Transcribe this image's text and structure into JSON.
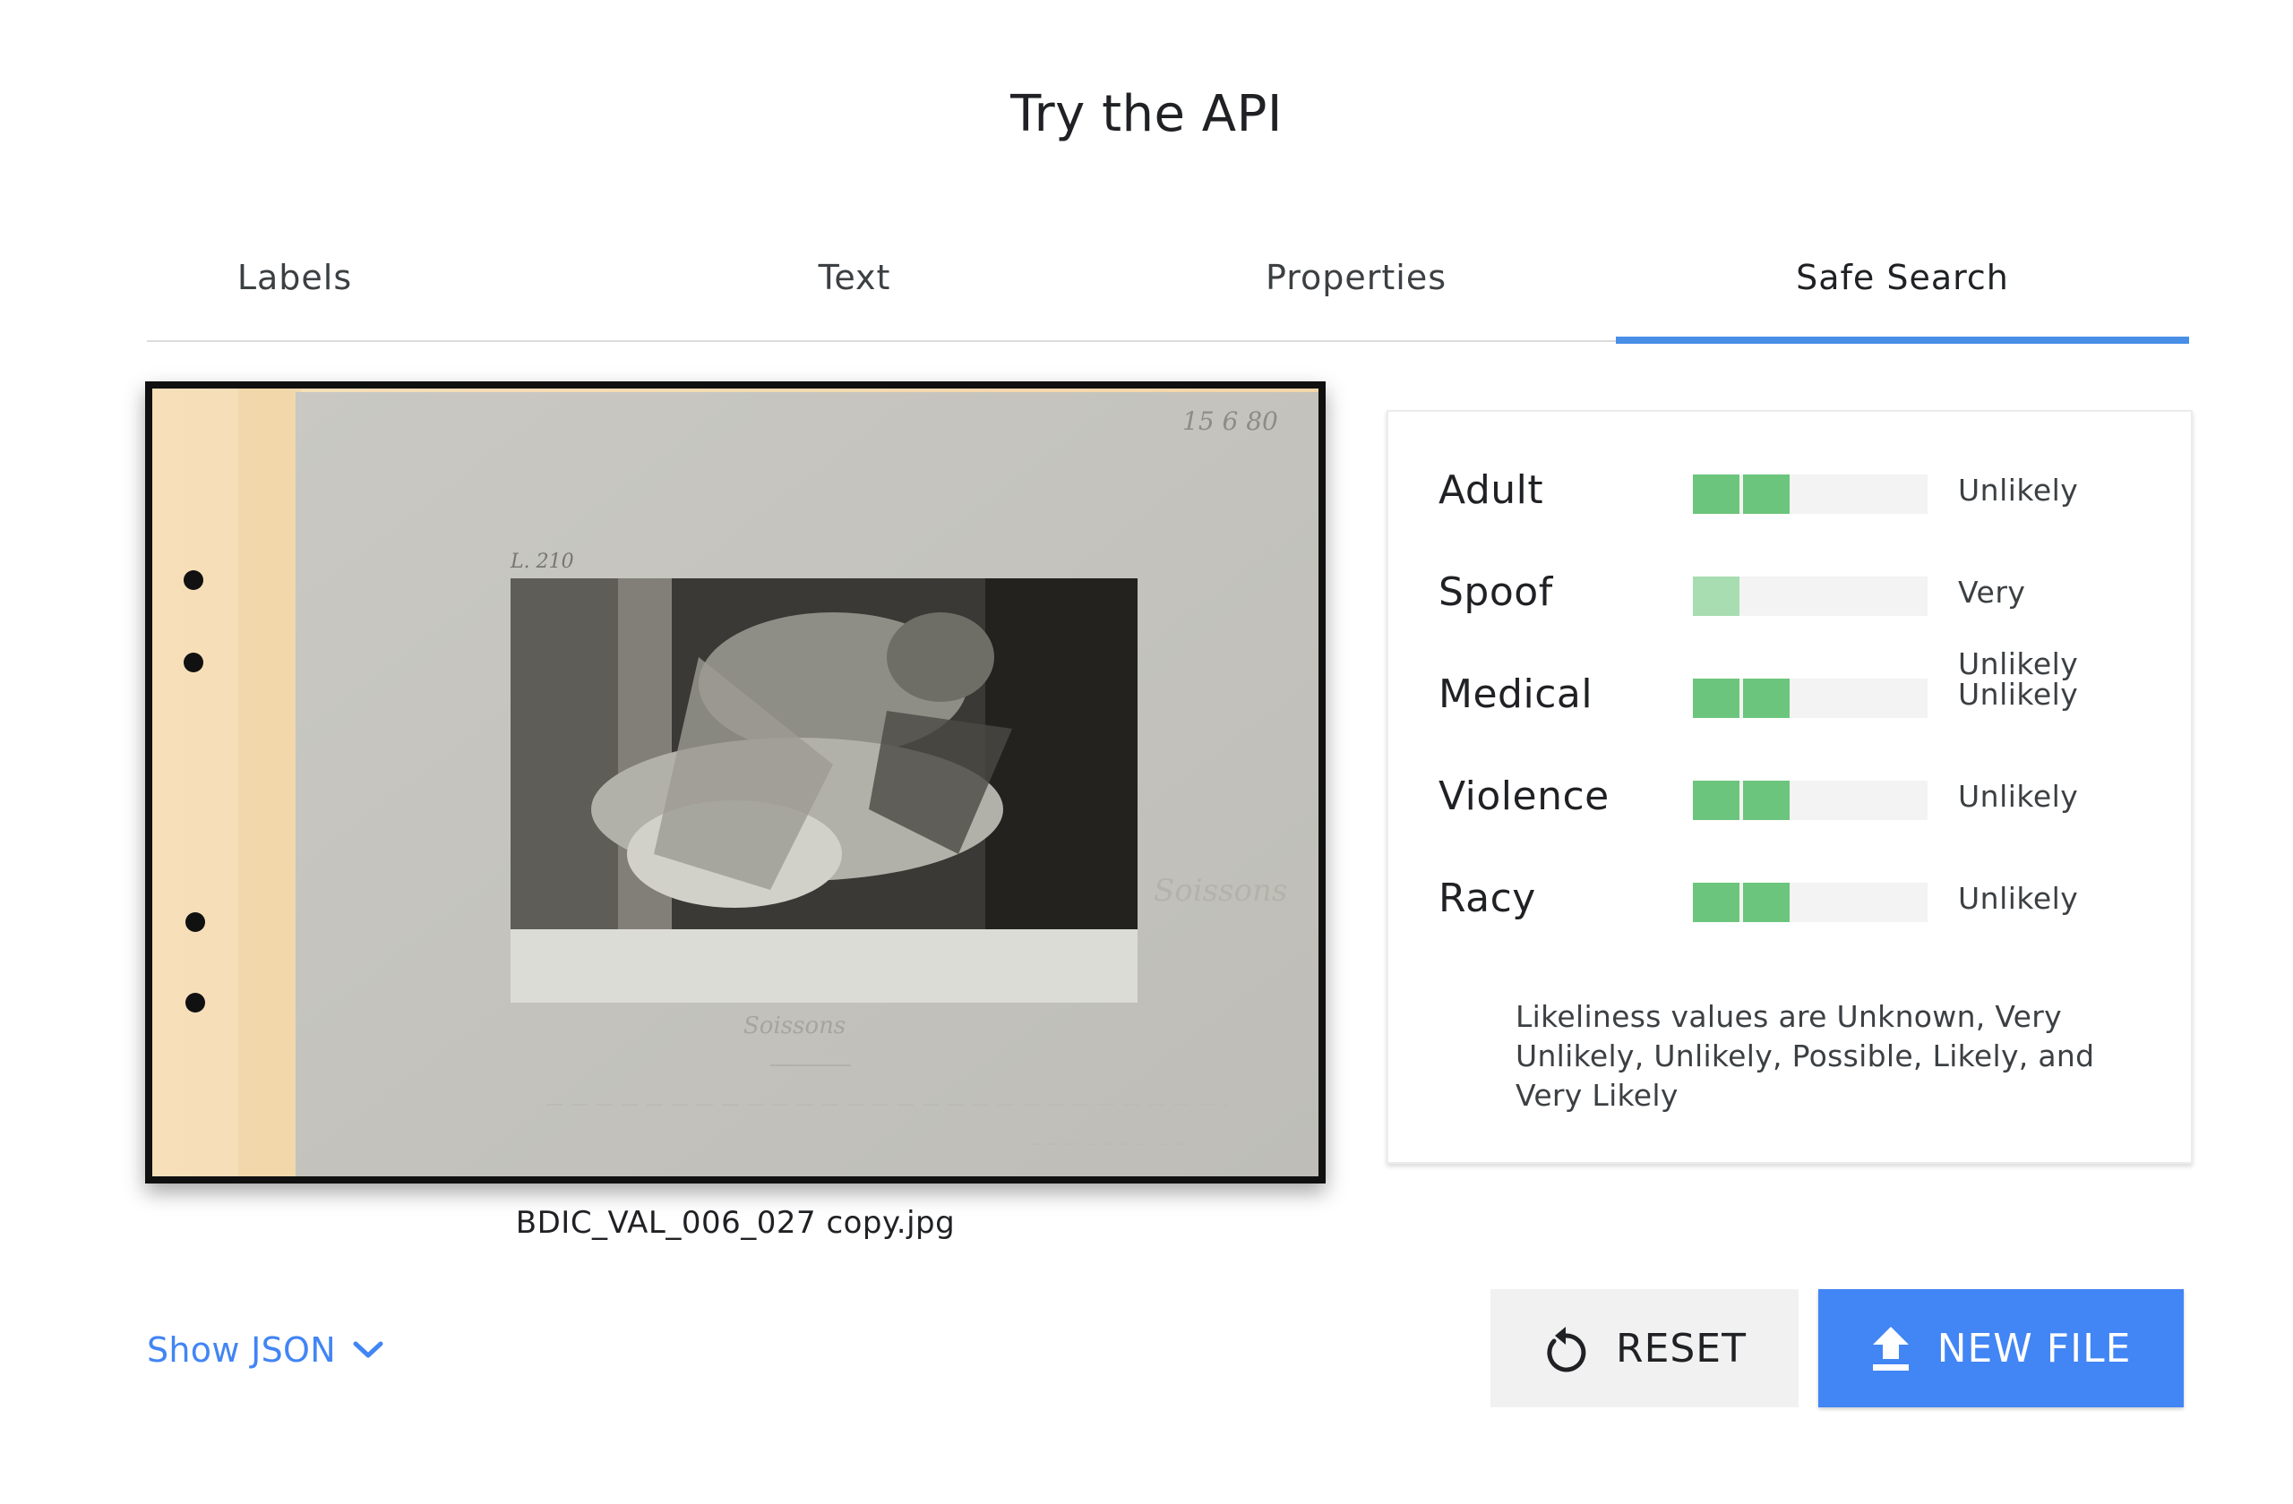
{
  "page": {
    "title": "Try the API"
  },
  "tabs": [
    {
      "label": "Labels",
      "active": false
    },
    {
      "label": "Text",
      "active": false
    },
    {
      "label": "Properties",
      "active": false
    },
    {
      "label": "Safe Search",
      "active": true
    }
  ],
  "image": {
    "file_name": "BDIC_VAL_006_027 copy.jpg",
    "handwritten_caption": "Soissons"
  },
  "safe_search": {
    "rows": [
      {
        "label": "Adult",
        "value": "Unlikely",
        "level": 2
      },
      {
        "label": "Spoof",
        "value": "Very Unlikely",
        "level": 1
      },
      {
        "label": "Medical",
        "value": "Unlikely",
        "level": 2
      },
      {
        "label": "Violence",
        "value": "Unlikely",
        "level": 2
      },
      {
        "label": "Racy",
        "value": "Unlikely",
        "level": 2
      }
    ],
    "max_level": 5,
    "note": "Likeliness values are Unknown, Very Unlikely, Unlikely, Possible, Likely, and Very Likely"
  },
  "actions": {
    "show_json": "Show JSON",
    "reset": "RESET",
    "new_file": "NEW FILE"
  },
  "colors": {
    "accent": "#4285f4",
    "tab_indicator": "#4a8fe7",
    "bar_unlikely": "#6cc57c",
    "bar_very_unlikely": "#a8dcb1",
    "bar_track": "#f3f3f3"
  }
}
